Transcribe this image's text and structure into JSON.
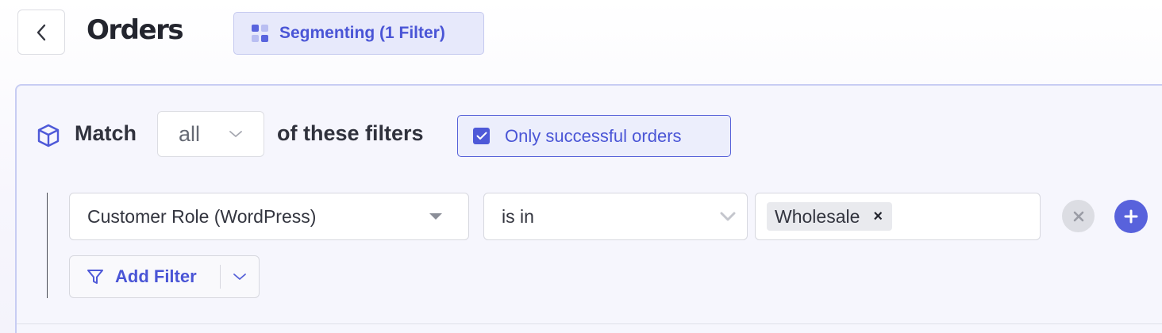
{
  "header": {
    "back_icon": "chevron-left-icon",
    "title": "Orders",
    "segment_button_label": "Segmenting (1 Filter)",
    "segment_icon": "grid-icon"
  },
  "match_bar": {
    "icon": "cube-icon",
    "match_label": "Match",
    "match_value": "all",
    "filters_label": "of these filters",
    "only_successful_label": "Only successful orders",
    "only_successful_checked": true
  },
  "filters": [
    {
      "field": "Customer Role (WordPress)",
      "operator": "is in",
      "values": [
        "Wholesale"
      ]
    }
  ],
  "actions": {
    "add_filter_label": "Add Filter"
  },
  "colors": {
    "accent": "#4a55d6",
    "accent_bg": "#e7e9fb",
    "panel_bg": "#f6f6fd",
    "panel_border": "#c8cdf3"
  }
}
